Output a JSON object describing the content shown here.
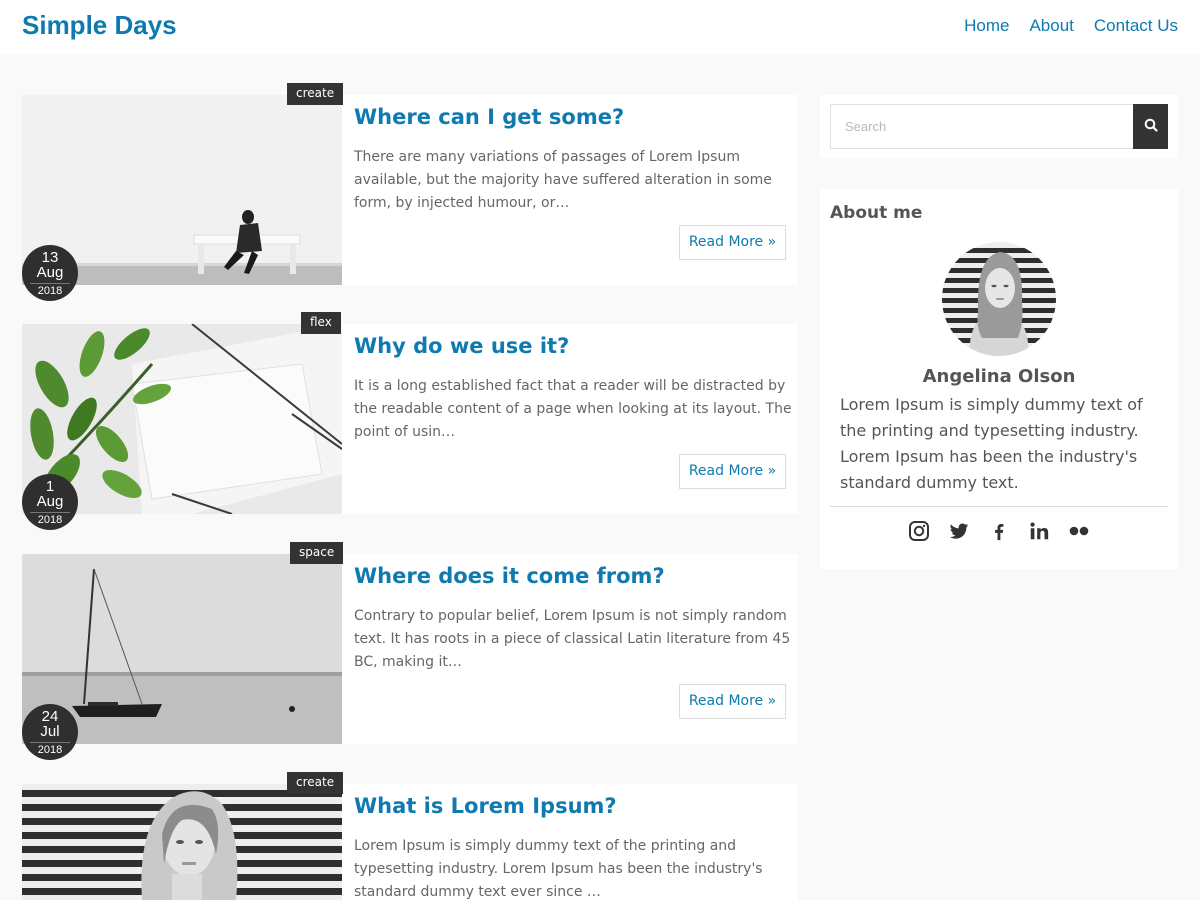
{
  "header": {
    "site_title": "Simple Days",
    "nav": [
      "Home",
      "About",
      "Contact Us"
    ]
  },
  "posts": [
    {
      "category": "create",
      "title": "Where can I get some?",
      "excerpt": "There are many variations of passages of Lorem Ipsum available, but the majority have suffered alteration in some form, by injected humour, or…",
      "read_more": "Read More »",
      "date": {
        "day": "13",
        "month": "Aug",
        "year": "2018"
      }
    },
    {
      "category": "flex",
      "title": "Why do we use it?",
      "excerpt": "It is a long established fact that a reader will be distracted by the readable content of a page when looking at its layout. The point of usin…",
      "read_more": "Read More »",
      "date": {
        "day": "1",
        "month": "Aug",
        "year": "2018"
      }
    },
    {
      "category": "space",
      "title": "Where does it come from?",
      "excerpt": "Contrary to popular belief, Lorem Ipsum is not simply random text. It has roots in a piece of classical Latin literature from 45 BC, making it…",
      "read_more": "Read More »",
      "date": {
        "day": "24",
        "month": "Jul",
        "year": "2018"
      }
    },
    {
      "category": "create",
      "title": "What is Lorem Ipsum?",
      "excerpt": "Lorem Ipsum is simply dummy text of the printing and typesetting industry. Lorem Ipsum has been the industry's standard dummy text ever since …"
    }
  ],
  "sidebar": {
    "search": {
      "placeholder": "Search"
    },
    "about": {
      "title": "About me",
      "name": "Angelina Olson",
      "bio": "Lorem Ipsum is simply dummy text of the printing and typesetting industry. Lorem Ipsum has been the industry's standard dummy text.",
      "socials": [
        "instagram-icon",
        "twitter-icon",
        "facebook-icon",
        "linkedin-icon",
        "flickr-icon"
      ]
    }
  },
  "colors": {
    "accent": "#0f7ab0",
    "dark": "#333333",
    "background": "#f9f9f9"
  }
}
